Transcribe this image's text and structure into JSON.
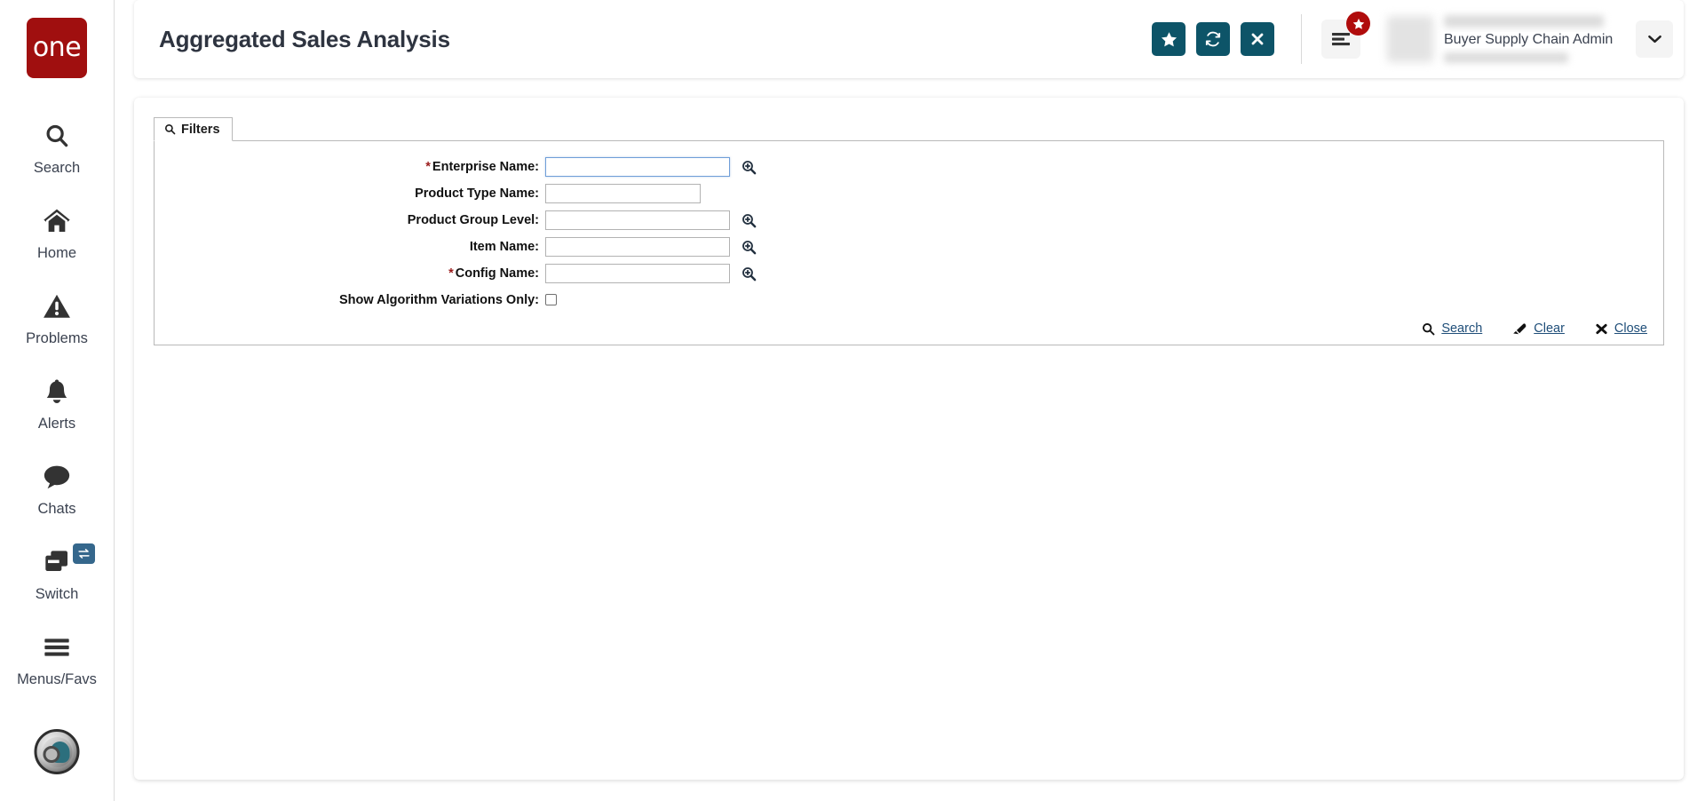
{
  "brand": {
    "logo_text": "one",
    "logo_color": "#a00f0f",
    "accent_teal": "#0d5468",
    "link_blue": "#1f4e79",
    "required_red": "#9b1c1c"
  },
  "sidebar": {
    "items": [
      {
        "label": "Search",
        "icon": "search-icon"
      },
      {
        "label": "Home",
        "icon": "home-icon"
      },
      {
        "label": "Problems",
        "icon": "warning-triangle-icon"
      },
      {
        "label": "Alerts",
        "icon": "bell-icon"
      },
      {
        "label": "Chats",
        "icon": "chat-bubble-icon"
      },
      {
        "label": "Switch",
        "icon": "switch-windows-icon",
        "badge_icon": "exchange-arrows-icon"
      },
      {
        "label": "Menus/Favs",
        "icon": "hamburger-icon"
      }
    ],
    "avatar_icon": "user-profile-globe-icon"
  },
  "header": {
    "title": "Aggregated Sales Analysis",
    "actions": [
      {
        "name": "favorite-button",
        "icon": "star-icon"
      },
      {
        "name": "refresh-button",
        "icon": "refresh-icon"
      },
      {
        "name": "close-button",
        "icon": "x-icon"
      }
    ],
    "menu_button": {
      "icon": "hamburger-icon",
      "badge_icon": "star-icon"
    },
    "user": {
      "role": "Buyer Supply Chain Admin",
      "name_masked": "",
      "sub_masked": ""
    },
    "chevron_icon": "chevron-down-icon"
  },
  "filters": {
    "tab_label": "Filters",
    "tab_icon": "search-icon",
    "fields": [
      {
        "label": "Enterprise Name:",
        "required": true,
        "value": "",
        "width": "long",
        "picker": true,
        "focused": true
      },
      {
        "label": "Product Type Name:",
        "required": false,
        "value": "",
        "width": "short",
        "picker": false,
        "focused": false
      },
      {
        "label": "Product Group Level:",
        "required": false,
        "value": "",
        "width": "long",
        "picker": true,
        "focused": false
      },
      {
        "label": "Item Name:",
        "required": false,
        "value": "",
        "width": "long",
        "picker": true,
        "focused": false
      },
      {
        "label": "Config Name:",
        "required": true,
        "value": "",
        "width": "long",
        "picker": true,
        "focused": false
      }
    ],
    "checkbox": {
      "label": "Show Algorithm Variations Only:",
      "checked": false
    },
    "actions": [
      {
        "label": "Search",
        "icon": "search-icon"
      },
      {
        "label": "Clear",
        "icon": "eraser-icon"
      },
      {
        "label": "Close",
        "icon": "x-icon"
      }
    ]
  }
}
